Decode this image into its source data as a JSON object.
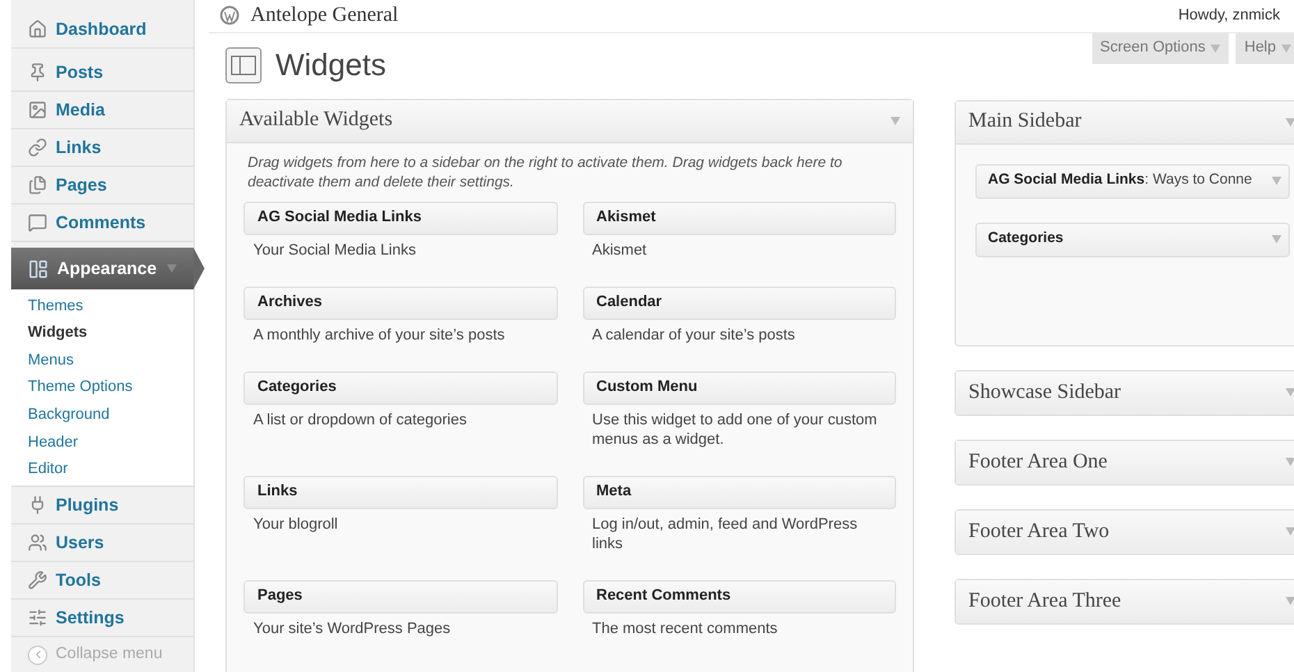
{
  "menu": [
    {
      "label": "Dashboard",
      "current": false
    },
    {
      "label": "Posts",
      "current": false
    },
    {
      "label": "Media",
      "current": false
    },
    {
      "label": "Links",
      "current": false
    },
    {
      "label": "Pages",
      "current": false
    },
    {
      "label": "Comments",
      "current": false
    },
    {
      "label": "Appearance",
      "current": true,
      "children": [
        {
          "label": "Themes",
          "selected": false
        },
        {
          "label": "Widgets",
          "selected": true
        },
        {
          "label": "Menus",
          "selected": false
        },
        {
          "label": "Theme Options",
          "selected": false
        },
        {
          "label": "Background",
          "selected": false
        },
        {
          "label": "Header",
          "selected": false
        },
        {
          "label": "Editor",
          "selected": false
        }
      ]
    },
    {
      "label": "Plugins",
      "current": false
    },
    {
      "label": "Users",
      "current": false
    },
    {
      "label": "Tools",
      "current": false
    },
    {
      "label": "Settings",
      "current": false
    }
  ],
  "collapse_menu": "Collapse menu",
  "site_title": "Antelope General",
  "greeting": "Howdy, znmick",
  "page_title": "Widgets",
  "screen_options": "Screen Options",
  "help": "Help",
  "available": {
    "title": "Available Widgets",
    "description": "Drag widgets from here to a sidebar on the right to activate them. Drag widgets back here to deactivate them and delete their settings.",
    "widgets": [
      {
        "name": "AG Social Media Links",
        "description": "Your Social Media Links"
      },
      {
        "name": "Akismet",
        "description": "Akismet"
      },
      {
        "name": "Archives",
        "description": "A monthly archive of your site’s posts"
      },
      {
        "name": "Calendar",
        "description": "A calendar of your site’s posts"
      },
      {
        "name": "Categories",
        "description": "A list or dropdown of categories"
      },
      {
        "name": "Custom Menu",
        "description": "Use this widget to add one of your custom menus as a widget."
      },
      {
        "name": "Links",
        "description": "Your blogroll"
      },
      {
        "name": "Meta",
        "description": "Log in/out, admin, feed and WordPress links"
      },
      {
        "name": "Pages",
        "description": "Your site’s WordPress Pages"
      },
      {
        "name": "Recent Comments",
        "description": "The most recent comments"
      }
    ]
  },
  "sidebars": [
    {
      "title": "Main Sidebar",
      "expanded": true,
      "widgets": [
        {
          "name": "AG Social Media Links",
          "suffix": ": Ways to Conne"
        },
        {
          "name": "Categories"
        }
      ]
    },
    {
      "title": "Showcase Sidebar",
      "expanded": false
    },
    {
      "title": "Footer Area One",
      "expanded": false
    },
    {
      "title": "Footer Area Two",
      "expanded": false
    },
    {
      "title": "Footer Area Three",
      "expanded": false
    }
  ]
}
